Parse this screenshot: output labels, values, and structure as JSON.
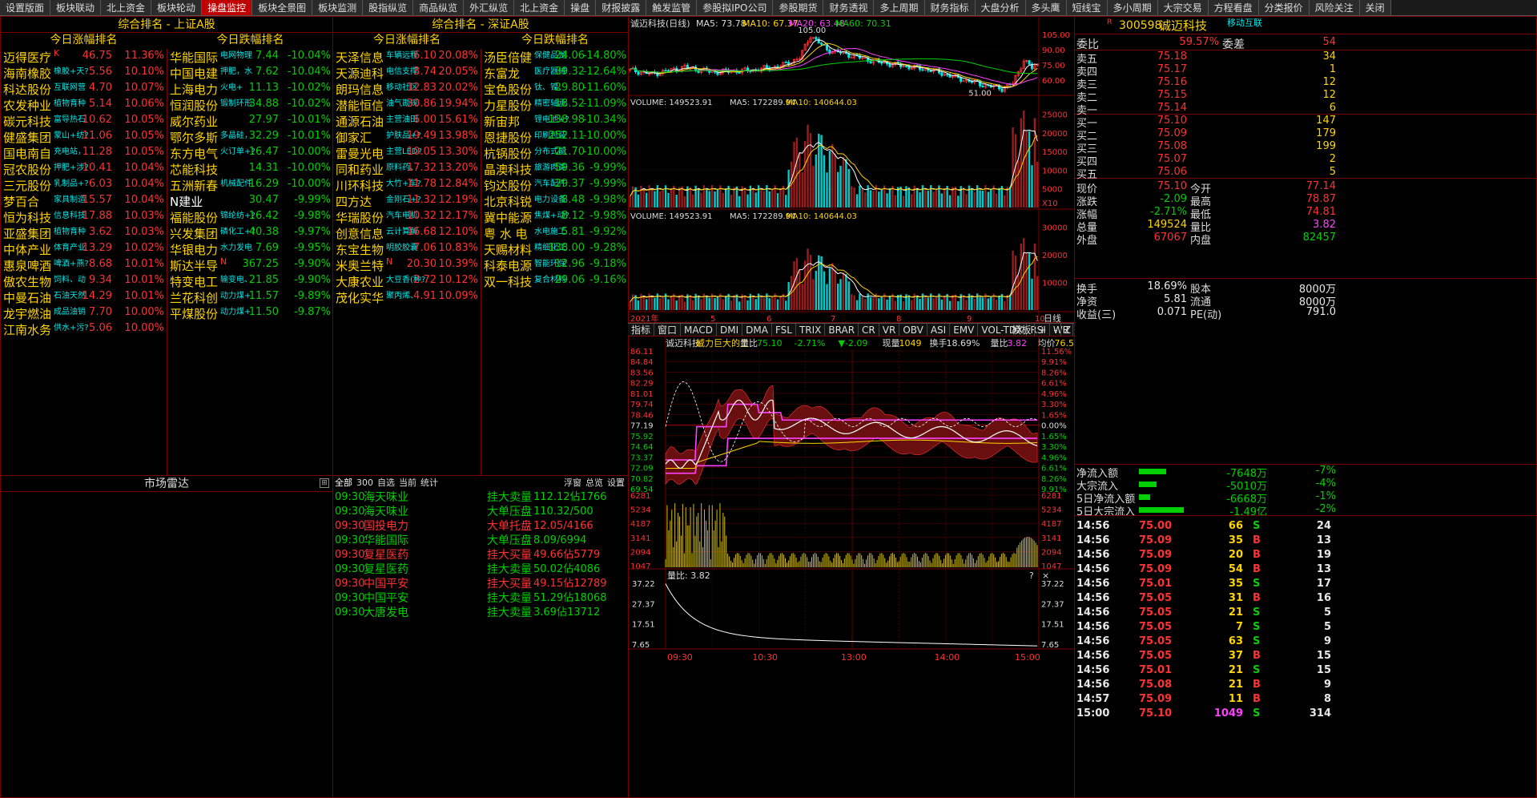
{
  "tabs": [
    "设置版面",
    "板块联动",
    "北上资金",
    "板块轮动",
    "操盘监控",
    "板块全景图",
    "板块监测",
    "股指纵览",
    "商品纵览",
    "外汇纵览",
    "北上资金",
    "操盘",
    "财报披露",
    "触发监管",
    "参股拟IPO公司",
    "参股期货",
    "财务透视",
    "多上周期",
    "财务指标",
    "大盘分析",
    "多头鹰",
    "短线宝",
    "多小周期",
    "大宗交易",
    "方程看盘",
    "分类报价",
    "风险关注",
    "关闭"
  ],
  "sh_panel": {
    "title": "综合排名 - 上证A股",
    "up_title": "今日涨幅排名",
    "down_title": "今日跌幅排名",
    "up": [
      {
        "name": "迈得医疗",
        "tag": "K",
        "price": "46.75",
        "chg": "11.36%"
      },
      {
        "name": "海南橡胶",
        "tag": "橡胶+天?",
        "price": "5.56",
        "chg": "10.10%"
      },
      {
        "name": "科达股份",
        "tag": "互联网营",
        "price": "4.70",
        "chg": "10.07%"
      },
      {
        "name": "农发种业",
        "tag": "植物育种",
        "price": "5.14",
        "chg": "10.06%"
      },
      {
        "name": "碳元科技",
        "tag": "富导热石",
        "price": "10.62",
        "chg": "10.05%"
      },
      {
        "name": "健盛集团",
        "tag": "蒙山+纺?",
        "price": "11.06",
        "chg": "10.05%"
      },
      {
        "name": "国电南自",
        "tag": "充电站，",
        "price": "11.28",
        "chg": "10.05%"
      },
      {
        "name": "冠农股份",
        "tag": "押肥+涉?",
        "price": "10.41",
        "chg": "10.04%"
      },
      {
        "name": "三元股份",
        "tag": "乳制品+?",
        "price": "6.03",
        "chg": "10.04%"
      },
      {
        "name": "梦百合",
        "tag": "家具制造",
        "price": "15.57",
        "chg": "10.04%"
      },
      {
        "name": "恒为科技",
        "tag": "信息科技",
        "price": "17.88",
        "chg": "10.03%"
      },
      {
        "name": "亚盛集团",
        "tag": "植物育种",
        "price": "3.62",
        "chg": "10.03%"
      },
      {
        "name": "中体产业",
        "tag": "体育产业",
        "price": "13.29",
        "chg": "10.02%"
      },
      {
        "name": "惠泉啤酒",
        "tag": "啤酒+燕?",
        "price": "8.68",
        "chg": "10.01%"
      },
      {
        "name": "傲农生物",
        "tag": "饲料、动",
        "price": "9.34",
        "chg": "10.01%"
      },
      {
        "name": "中曼石油",
        "tag": "石油天然",
        "price": "14.29",
        "chg": "10.01%"
      },
      {
        "name": "龙宇燃油",
        "tag": "成品油销",
        "price": "7.70",
        "chg": "10.00%"
      },
      {
        "name": "江南水务",
        "tag": "供水+污?",
        "price": "5.06",
        "chg": "10.00%"
      }
    ],
    "down": [
      {
        "name": "华能国际",
        "tag": "电网物理",
        "price": "7.44",
        "chg": "-10.04%"
      },
      {
        "name": "中国电建",
        "tag": "押肥，水",
        "price": "7.62",
        "chg": "-10.04%"
      },
      {
        "name": "上海电力",
        "tag": "火电+",
        "price": "11.13",
        "chg": "-10.02%"
      },
      {
        "name": "恒润股份",
        "tag": "锻制环形",
        "price": "34.88",
        "chg": "-10.02%"
      },
      {
        "name": "威尔药业",
        "tag": "",
        "price": "27.97",
        "chg": "-10.01%"
      },
      {
        "name": "鄂尔多斯",
        "tag": "多晶硅，",
        "price": "32.29",
        "chg": "-10.01%"
      },
      {
        "name": "东方电气",
        "tag": "火订单+?",
        "price": "16.47",
        "chg": "-10.00%"
      },
      {
        "name": "芯能科技",
        "tag": "",
        "price": "14.31",
        "chg": "-10.00%"
      },
      {
        "name": "五洲新春",
        "tag": "机械配件",
        "price": "16.29",
        "chg": "-10.00%"
      },
      {
        "name": "N建业",
        "tag": "",
        "price": "30.47",
        "chg": "-9.99%"
      },
      {
        "name": "福能股份",
        "tag": "锦纶纺+?",
        "price": "16.42",
        "chg": "-9.98%"
      },
      {
        "name": "兴发集团",
        "tag": "磷化工+?",
        "price": "40.38",
        "chg": "-9.97%"
      },
      {
        "name": "华银电力",
        "tag": "水力发电",
        "price": "7.69",
        "chg": "-9.95%"
      },
      {
        "name": "斯达半导",
        "tag": "N",
        "price": "367.25",
        "chg": "-9.90%"
      },
      {
        "name": "特变电工",
        "tag": "输变电、",
        "price": "21.85",
        "chg": "-9.90%"
      },
      {
        "name": "兰花科创",
        "tag": "动力煤+",
        "price": "11.57",
        "chg": "-9.89%"
      },
      {
        "name": "平煤股份",
        "tag": "动力煤+",
        "price": "11.50",
        "chg": "-9.87%"
      }
    ]
  },
  "sz_panel": {
    "title": "综合排名 - 深证A股",
    "up_title": "今日涨幅排名",
    "down_title": "今日跌幅排名",
    "up": [
      {
        "name": "天泽信息",
        "tag": "车辆远程",
        "price": "6.10",
        "chg": "20.08%"
      },
      {
        "name": "天源迪科",
        "tag": "电信支撑",
        "price": "8.74",
        "chg": "20.05%"
      },
      {
        "name": "朗玛信息",
        "tag": "移动社区",
        "price": "12.83",
        "chg": "20.02%"
      },
      {
        "name": "潜能恒信",
        "tag": "油气勘探",
        "price": "30.86",
        "chg": "19.94%"
      },
      {
        "name": "通源石油",
        "tag": "主营油田",
        "price": "6.00",
        "chg": "15.61%"
      },
      {
        "name": "御家汇",
        "tag": "护肤品+?",
        "price": "19.49",
        "chg": "13.98%"
      },
      {
        "name": "雷曼光电",
        "tag": "主营LED?",
        "price": "10.05",
        "chg": "13.30%"
      },
      {
        "name": "同和药业",
        "tag": "原料药、",
        "price": "17.32",
        "chg": "13.20%"
      },
      {
        "name": "川环科技",
        "tag": "大竹+车?",
        "price": "11.78",
        "chg": "12.84%"
      },
      {
        "name": "四方达",
        "tag": "金刚石+?",
        "price": "11.32",
        "chg": "12.19%"
      },
      {
        "name": "华瑞股份",
        "tag": "汽车电机",
        "price": "10.32",
        "chg": "12.17%"
      },
      {
        "name": "创意信息",
        "tag": "云计算解",
        "price": "16.68",
        "chg": "12.10%"
      },
      {
        "name": "东宝生物",
        "tag": "明胶胶囊",
        "price": "7.06",
        "chg": "10.83%"
      },
      {
        "name": "米奥兰特",
        "tag": "N",
        "price": "20.30",
        "chg": "10.39%"
      },
      {
        "name": "大康农业",
        "tag": "大豆香(种?",
        "price": "2.72",
        "chg": "10.12%"
      },
      {
        "name": "茂化实华",
        "tag": "聚丙烯、",
        "price": "4.91",
        "chg": "10.09%"
      }
    ],
    "down": [
      {
        "name": "汤臣倍健",
        "tag": "保健品龙",
        "price": "24.06",
        "chg": "-14.80%"
      },
      {
        "name": "东富龙",
        "tag": "医疗器械",
        "price": "39.32",
        "chg": "-12.64%"
      },
      {
        "name": "宝色股份",
        "tag": "钛、镍、",
        "price": "29.80",
        "chg": "-11.60%"
      },
      {
        "name": "力星股份",
        "tag": "精密轴承",
        "price": "18.52",
        "chg": "-11.09%"
      },
      {
        "name": "新宙邦",
        "tag": "锂电池+?",
        "price": "138.98",
        "chg": "-10.34%"
      },
      {
        "name": "恩捷股份",
        "tag": "印刷包装",
        "price": "252.11",
        "chg": "-10.00%"
      },
      {
        "name": "杭锅股份",
        "tag": "分布式能",
        "price": "21.70",
        "chg": "-10.00%"
      },
      {
        "name": "晶澳科技",
        "tag": "旅游肉类",
        "price": "59.36",
        "chg": "-9.99%"
      },
      {
        "name": "钧达股份",
        "tag": "汽车配件",
        "price": "29.37",
        "chg": "-9.99%"
      },
      {
        "name": "北京科锐",
        "tag": "电力设备",
        "price": "8.48",
        "chg": "-9.98%"
      },
      {
        "name": "冀中能源",
        "tag": "焦煤+动?",
        "price": "8.12",
        "chg": "-9.98%"
      },
      {
        "name": "粤 水 电",
        "tag": "水电施工",
        "price": "5.81",
        "chg": "-9.92%"
      },
      {
        "name": "天赐材料",
        "tag": "精细化工",
        "price": "138.00",
        "chg": "-9.28%"
      },
      {
        "name": "科泰电源",
        "tag": "智能环保",
        "price": "12.96",
        "chg": "-9.18%"
      },
      {
        "name": "双一科技",
        "tag": "复合材料",
        "price": "29.06",
        "chg": "-9.16%"
      }
    ]
  },
  "radar": {
    "title": "市场雷达"
  },
  "quotes": {
    "filters": [
      "全部",
      "300",
      "自选",
      "当前",
      "统计"
    ],
    "right": [
      "浮窗",
      "总览",
      "设置"
    ],
    "rows": [
      {
        "time": "09:30",
        "name": "海天味业",
        "type": "挂大卖量",
        "val": "112.12佔1766",
        "color": "grn"
      },
      {
        "time": "09:30",
        "name": "海天味业",
        "type": "大单压盘",
        "val": "110.32/500",
        "color": "grn"
      },
      {
        "time": "09:30",
        "name": "国投电力",
        "type": "大单托盘",
        "val": "12.05/4166",
        "color": "red"
      },
      {
        "time": "09:30",
        "name": "华能国际",
        "type": "大单压盘",
        "val": "8.09/6994",
        "color": "grn"
      },
      {
        "time": "09:30",
        "name": "复星医药",
        "type": "挂大买量",
        "val": "49.66佔5779",
        "color": "red"
      },
      {
        "time": "09:30",
        "name": "复星医药",
        "type": "挂大卖量",
        "val": "50.02佔4086",
        "color": "grn"
      },
      {
        "time": "09:30",
        "name": "中国平安",
        "type": "挂大买量",
        "val": "49.15佔12789",
        "color": "red"
      },
      {
        "time": "09:30",
        "name": "中国平安",
        "type": "挂大卖量",
        "val": "51.29佔18068",
        "color": "grn"
      },
      {
        "time": "09:30",
        "name": "大唐发电",
        "type": "挂大卖量",
        "val": "3.69佔13712",
        "color": "grn"
      }
    ]
  },
  "kline": {
    "stock": "诚迈科技(日线)",
    "ma5": "MA5: 73.78",
    "ma10": "MA10: 67.37",
    "ma20": "MA20: 63.48",
    "ma60": "MA60: 70.31",
    "high_label": "105.00",
    "low_label": "51.00",
    "yticks": [
      "105.00",
      "90.00",
      "75.00",
      "60.00"
    ],
    "vol_label": "VOLUME: 149523.91",
    "vol_ma5": "MA5: 172289.94",
    "vol_ma10": "MA10: 140644.03",
    "vol_ticks": [
      "25000",
      "20000",
      "15000",
      "10000",
      "5000"
    ],
    "vol2_ticks": [
      "30000",
      "20000",
      "10000"
    ],
    "vol_unit": "X10",
    "xlabels": [
      "2021年",
      "5",
      "6",
      "7",
      "8",
      "9",
      "10"
    ],
    "period": "日线",
    "ind_tabs": [
      "指标",
      "窗口",
      "MACD",
      "DMI",
      "DMA",
      "FSL",
      "TRIX",
      "BRAR",
      "CR",
      "VR",
      "OBV",
      "ASI",
      "EMV",
      "VOL-TDX",
      "RSI",
      "WR",
      "SAR"
    ],
    "ind_right": [
      "模板",
      "+",
      "-",
      "Z"
    ]
  },
  "intraday": {
    "stock": "诚迈科技",
    "slogan": "威力巨大的主",
    "lb_label": "量比",
    "price": "75.10",
    "chg": "-2.71%",
    "diff": "▼-2.09",
    "xl_label": "现量",
    "xl": "1049",
    "hs_label": "换手",
    "hs": "18.69%",
    "lb2_label": "量比",
    "lb2": "3.82",
    "jj_label": "均价",
    "jj": "76.50",
    "ylab": [
      "86.11",
      "84.84",
      "83.56",
      "82.29",
      "81.01",
      "79.74",
      "78.46",
      "77.19",
      "75.92",
      "74.64",
      "73.37",
      "72.09",
      "70.82",
      "69.54"
    ],
    "rlab": [
      "11.56%",
      "9.91%",
      "8.26%",
      "6.61%",
      "4.96%",
      "3.30%",
      "1.65%",
      "0.00%",
      "1.65%",
      "3.30%",
      "4.96%",
      "6.61%",
      "8.26%",
      "9.91%"
    ],
    "vlab": [
      "6281",
      "5234",
      "4187",
      "3141",
      "2094",
      "1047"
    ],
    "lb_title": "量比: 3.82",
    "lb_ticks": [
      "37.22",
      "27.37",
      "17.51",
      "7.65"
    ],
    "times": [
      "09:30",
      "10:30",
      "13:00",
      "14:00",
      "15:00"
    ]
  },
  "orderbook": {
    "code": "300598",
    "name": "诚迈科技",
    "tag": "移动互联",
    "wb_label": "委比",
    "wb": "59.57%",
    "wc_label": "委差",
    "wc": "54",
    "sells": [
      {
        "label": "卖五",
        "price": "75.18",
        "vol": "34"
      },
      {
        "label": "卖四",
        "price": "75.17",
        "vol": "1"
      },
      {
        "label": "卖三",
        "price": "75.16",
        "vol": "12"
      },
      {
        "label": "卖二",
        "price": "75.15",
        "vol": "12"
      },
      {
        "label": "卖一",
        "price": "75.14",
        "vol": "6"
      }
    ],
    "buys": [
      {
        "label": "买一",
        "price": "75.10",
        "vol": "147"
      },
      {
        "label": "买二",
        "price": "75.09",
        "vol": "179"
      },
      {
        "label": "买三",
        "price": "75.08",
        "vol": "199"
      },
      {
        "label": "买四",
        "price": "75.07",
        "vol": "2"
      },
      {
        "label": "买五",
        "price": "75.06",
        "vol": "5"
      }
    ],
    "info": [
      {
        "l1": "现价",
        "v1": "75.10",
        "c1": "red",
        "l2": "今开",
        "v2": "77.14",
        "c2": "red"
      },
      {
        "l1": "涨跌",
        "v1": "-2.09",
        "c1": "grn",
        "l2": "最高",
        "v2": "78.87",
        "c2": "red"
      },
      {
        "l1": "涨幅",
        "v1": "-2.71%",
        "c1": "grn",
        "l2": "最低",
        "v2": "74.81",
        "c2": "red"
      },
      {
        "l1": "总量",
        "v1": "149524",
        "c1": "yel",
        "l2": "量比",
        "v2": "3.82",
        "c2": "mag"
      },
      {
        "l1": "外盘",
        "v1": "67067",
        "c1": "red",
        "l2": "内盘",
        "v2": "82457",
        "c2": "grn"
      },
      {
        "l1": "换手",
        "v1": "18.69%",
        "c1": "wht",
        "l2": "股本",
        "v2": "8000万",
        "c2": "wht"
      },
      {
        "l1": "净资",
        "v1": "5.81",
        "c1": "wht",
        "l2": "流通",
        "v2": "8000万",
        "c2": "wht"
      },
      {
        "l1": "收益(三)",
        "v1": "0.071",
        "c1": "wht",
        "l2": "PE(动)",
        "v2": "791.0",
        "c2": "wht"
      }
    ],
    "flows": [
      {
        "label": "净流入额",
        "val": "-7648万",
        "pct": "-7%",
        "bar": 0.6
      },
      {
        "label": "大宗流入",
        "val": "-5010万",
        "pct": "-4%",
        "bar": 0.4
      },
      {
        "label": "5日净流入额",
        "val": "-6668万",
        "pct": "-1%",
        "bar": 0.25
      },
      {
        "label": "5日大宗流入",
        "val": "-1.49亿",
        "pct": "-2%",
        "bar": 1.0
      }
    ],
    "trades": [
      {
        "t": "14:56",
        "p": "75.00",
        "v": "66",
        "bs": "S",
        "n": "24"
      },
      {
        "t": "14:56",
        "p": "75.09",
        "v": "35",
        "bs": "B",
        "n": "13"
      },
      {
        "t": "14:56",
        "p": "75.09",
        "v": "20",
        "bs": "B",
        "n": "19"
      },
      {
        "t": "14:56",
        "p": "75.09",
        "v": "54",
        "bs": "B",
        "n": "13"
      },
      {
        "t": "14:56",
        "p": "75.01",
        "v": "35",
        "bs": "S",
        "n": "17"
      },
      {
        "t": "14:56",
        "p": "75.05",
        "v": "31",
        "bs": "B",
        "n": "16"
      },
      {
        "t": "14:56",
        "p": "75.05",
        "v": "21",
        "bs": "S",
        "n": "5"
      },
      {
        "t": "14:56",
        "p": "75.05",
        "v": "7",
        "bs": "S",
        "n": "5"
      },
      {
        "t": "14:56",
        "p": "75.05",
        "v": "63",
        "bs": "S",
        "n": "9"
      },
      {
        "t": "14:56",
        "p": "75.05",
        "v": "37",
        "bs": "B",
        "n": "15"
      },
      {
        "t": "14:56",
        "p": "75.01",
        "v": "21",
        "bs": "S",
        "n": "15"
      },
      {
        "t": "14:56",
        "p": "75.08",
        "v": "21",
        "bs": "B",
        "n": "9"
      },
      {
        "t": "14:57",
        "p": "75.09",
        "v": "11",
        "bs": "B",
        "n": "8"
      },
      {
        "t": "15:00",
        "p": "75.10",
        "v": "1049",
        "bs": "S",
        "n": "314"
      }
    ]
  },
  "chart_data": [
    {
      "type": "candlestick",
      "title": "诚迈科技(日线)",
      "ylim": [
        51,
        105
      ],
      "ma": {
        "MA5": 73.78,
        "MA10": 67.37,
        "MA20": 63.48,
        "MA60": 70.31
      },
      "high": 105.0,
      "low": 51.0
    },
    {
      "type": "bar",
      "title": "VOLUME",
      "last": 149523.91,
      "ma5": 172289.94,
      "ma10": 140644.03,
      "ylim": [
        0,
        27000
      ]
    },
    {
      "type": "line",
      "title": "诚迈科技 分时",
      "ylim": [
        69.54,
        86.11
      ],
      "prev_close": 77.19,
      "last": 75.1,
      "avg": 76.5,
      "x": [
        "09:30",
        "10:30",
        "13:00",
        "14:00",
        "15:00"
      ]
    },
    {
      "type": "line",
      "title": "量比",
      "ylim": [
        7.65,
        37.22
      ],
      "last": 3.82
    }
  ],
  "colors": {
    "up": "#ff3232",
    "down": "#00d000",
    "vol_up": "#9b1c1c",
    "vol_down": "#00cccc",
    "grid": "#7a0000",
    "accent": "#ffd400"
  }
}
